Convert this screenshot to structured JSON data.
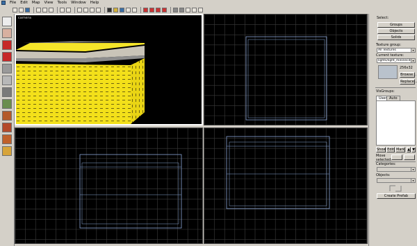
{
  "menu": [
    "File",
    "Edit",
    "Map",
    "View",
    "Tools",
    "Window",
    "Help"
  ],
  "viewports": {
    "camera_label": "camera",
    "top_right": "",
    "bottom_left": "",
    "bottom_right": ""
  },
  "panel": {
    "select_label": "Select:",
    "groups_btn": "Groups",
    "objects_btn": "Objects",
    "solids_btn": "Solids",
    "texture_group_label": "Texture group:",
    "texture_group_value": "All Textures",
    "current_texture_label": "Current texture:",
    "current_texture_value": "lights/light_mesnecdox",
    "texture_size": "256x32",
    "browse_btn": "Browse...",
    "replace_btn": "Replace...",
    "visgroups_label": "VisGroups:",
    "tab_user": "User",
    "tab_auto": "Auto",
    "show_btn": "Show",
    "edit_btn": "Edit",
    "mark_btn": "Mark",
    "move_selected_label": "Move selected:",
    "categories_label": "Categories:",
    "objects_label": "Objects:",
    "create_prefab_btn": "Create Prefab"
  },
  "colors": {
    "viewport_bg": "#000000",
    "grid": "#3c3c3c",
    "brush_wire": "#8aa6d6",
    "block_yellow": "#f3e01a",
    "panel_bg": "#d4d0c8"
  }
}
